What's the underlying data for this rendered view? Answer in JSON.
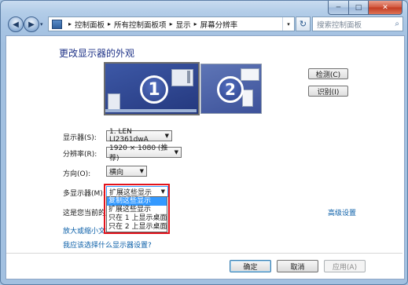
{
  "window": {
    "minimize_icon": "minimize-icon",
    "maximize_icon": "maximize-icon",
    "close_icon": "close-icon",
    "min_glyph": "─",
    "max_glyph": "□",
    "close_glyph": "✕"
  },
  "nav": {
    "back_glyph": "◀",
    "forward_glyph": "▶",
    "history_glyph": "▾",
    "breadcrumb": [
      "控制面板",
      "所有控制面板项",
      "显示",
      "屏幕分辨率"
    ],
    "separator": "▸",
    "root_separator": "▸",
    "address_dropdown_glyph": "▾",
    "refresh_glyph": "↻",
    "search_placeholder": "搜索控制面板",
    "search_glyph": "⌕"
  },
  "page": {
    "title": "更改显示器的外观",
    "monitor1_number": "1",
    "monitor2_number": "2",
    "detect_button": "检测(C)",
    "identify_button": "识别(I)"
  },
  "form": {
    "display_label": "显示器(S):",
    "display_value": "1. LEN LI2361dwA",
    "resolution_label": "分辨率(R):",
    "resolution_value": "1920 × 1080 (推荐)",
    "orientation_label": "方向(O):",
    "orientation_value": "横向",
    "multi_display_label": "多显示器(M):",
    "multi_display_value": "扩展这些显示",
    "multi_display_options": [
      "复制这些显示",
      "扩展这些显示",
      "只在 1 上显示桌面",
      "只在 2 上显示桌面"
    ],
    "multi_display_highlighted_index": 0,
    "dropdown_arrow": "▼"
  },
  "info": {
    "main_display_text": "这是您当前的主",
    "advanced_link": "高级设置",
    "enlarge_link": "放大或缩小文本",
    "help_link": "我应该选择什么显示器设置?"
  },
  "footer": {
    "ok": "确定",
    "cancel": "取消",
    "apply": "应用(A)"
  },
  "colors": {
    "highlight": "#3399ff",
    "annotation_box": "#e3121b",
    "link": "#0b5fa8"
  }
}
